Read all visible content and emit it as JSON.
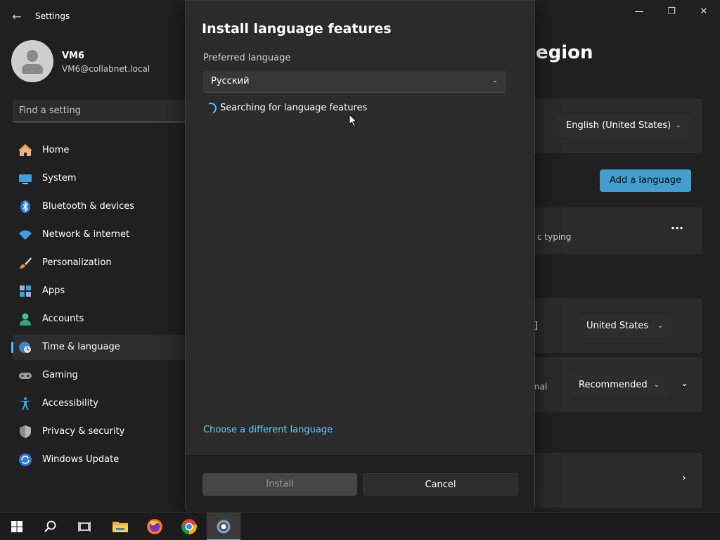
{
  "window": {
    "app_title": "Settings",
    "back_icon": "←",
    "minimize_icon": "—",
    "maximize_icon": "❐",
    "close_icon": "✕"
  },
  "profile": {
    "name": "VM6",
    "email": "VM6@collabnet.local"
  },
  "search": {
    "placeholder": "Find a setting"
  },
  "sidebar": {
    "items": [
      {
        "label": "Home",
        "icon": "home-icon",
        "selected": false
      },
      {
        "label": "System",
        "icon": "system-icon",
        "selected": false
      },
      {
        "label": "Bluetooth & devices",
        "icon": "bluetooth-icon",
        "selected": false
      },
      {
        "label": "Network & internet",
        "icon": "network-icon",
        "selected": false
      },
      {
        "label": "Personalization",
        "icon": "brush-icon",
        "selected": false
      },
      {
        "label": "Apps",
        "icon": "apps-icon",
        "selected": false
      },
      {
        "label": "Accounts",
        "icon": "accounts-icon",
        "selected": false
      },
      {
        "label": "Time & language",
        "icon": "globe-clock-icon",
        "selected": true
      },
      {
        "label": "Gaming",
        "icon": "gamepad-icon",
        "selected": false
      },
      {
        "label": "Accessibility",
        "icon": "accessibility-icon",
        "selected": false
      },
      {
        "label": "Privacy & security",
        "icon": "shield-icon",
        "selected": false
      },
      {
        "label": "Windows Update",
        "icon": "update-icon",
        "selected": false
      }
    ]
  },
  "background_page": {
    "heading_fragment": "egion",
    "display_language": "English (United States)",
    "add_language_label": "Add a language",
    "more_icon": "···",
    "typing_fragment": "c typing",
    "region_fragment": "]",
    "country": "United States",
    "regional_fragment": "nal",
    "regional_format": "Recommended"
  },
  "dialog": {
    "title": "Install language features",
    "preferred_label": "Preferred language",
    "selected_language": "Русский",
    "status_text": "Searching for language features",
    "choose_link": "Choose a different language",
    "install_label": "Install",
    "cancel_label": "Cancel"
  },
  "taskbar": {
    "items": [
      "start-icon",
      "search-icon",
      "task-view-icon",
      "file-explorer-icon",
      "firefox-icon",
      "chrome-icon",
      "settings-icon"
    ],
    "active": "settings-icon"
  },
  "colors": {
    "accent": "#4cc2ff",
    "link": "#60cdff",
    "background": "#202020",
    "dialog": "#2b2b2b"
  }
}
